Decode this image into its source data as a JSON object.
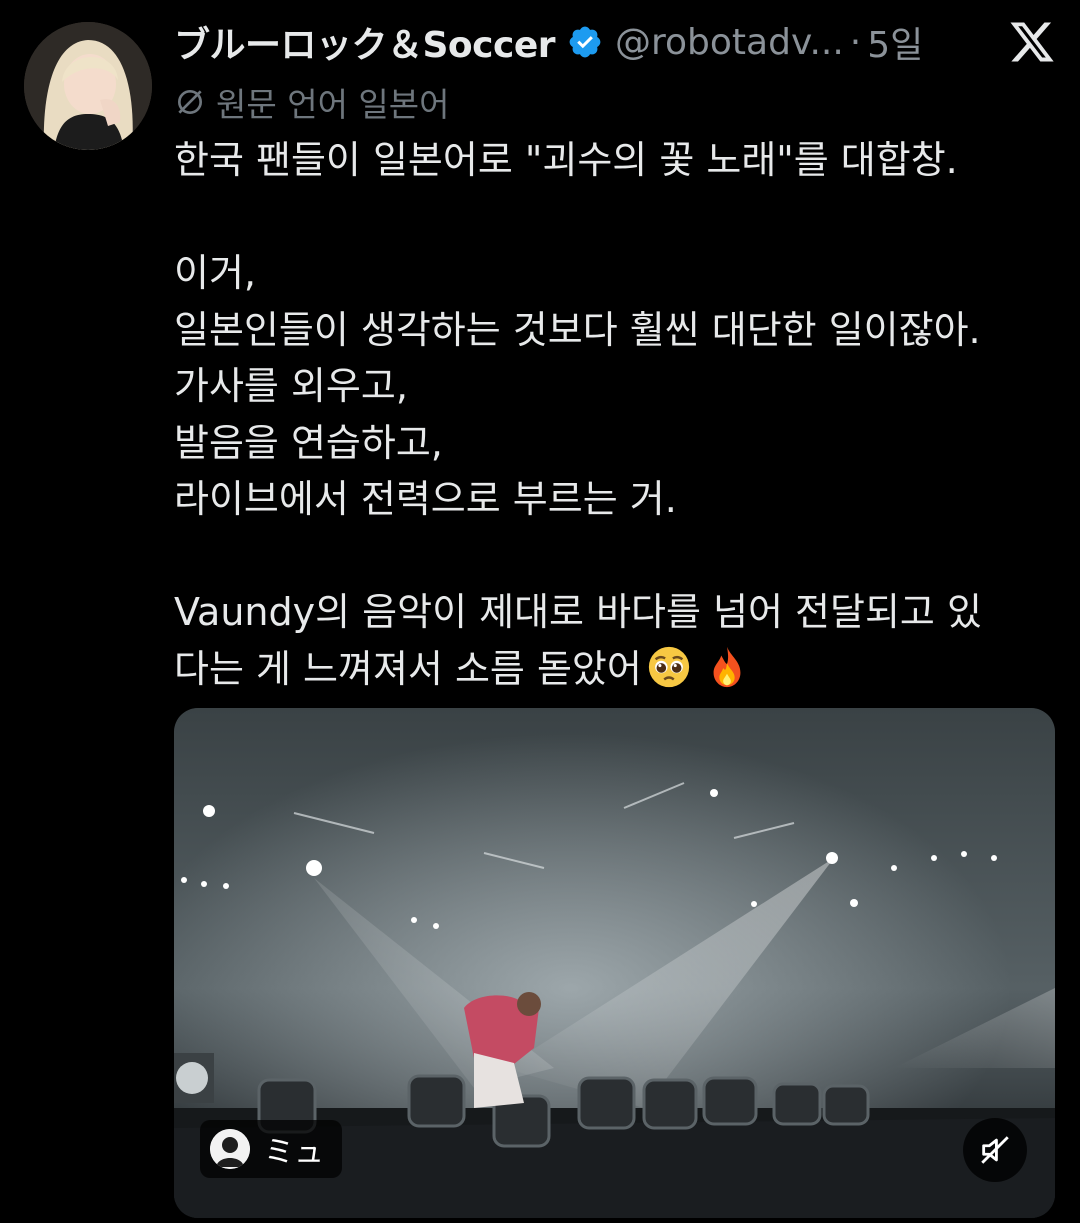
{
  "post": {
    "display_name": "ブルーロック＆Soccer",
    "handle": "@robotadv...",
    "separator": "·",
    "time": "5일",
    "translation_label": "원문 언어 일본어",
    "text": "한국 팬들이 일본어로 \"괴수의 꽃 노래\"를 대합창.\n\n이거,\n일본인들이 생각하는 것보다 훨씬 대단한 일이잖아.\n가사를 외우고,\n발음을 연습하고,\n라이브에서 전력으로 부르는 거.\n\nVaundy의 음악이 제대로 바다를 넘어 전달되고 있\n다는 게 느껴져서 소름 돋았어",
    "emojis": [
      "pleading-face",
      "fire"
    ]
  },
  "media": {
    "user_tag": "ミュ",
    "mute_icon": "speaker-muted-icon"
  },
  "icons": {
    "verified": "verified-badge-icon",
    "x_logo": "x-logo-icon",
    "translate": "globe-slash-icon"
  },
  "colors": {
    "background": "#000000",
    "text": "#e7e9ea",
    "secondary": "#8b9299",
    "verified": "#1d9bf0"
  }
}
